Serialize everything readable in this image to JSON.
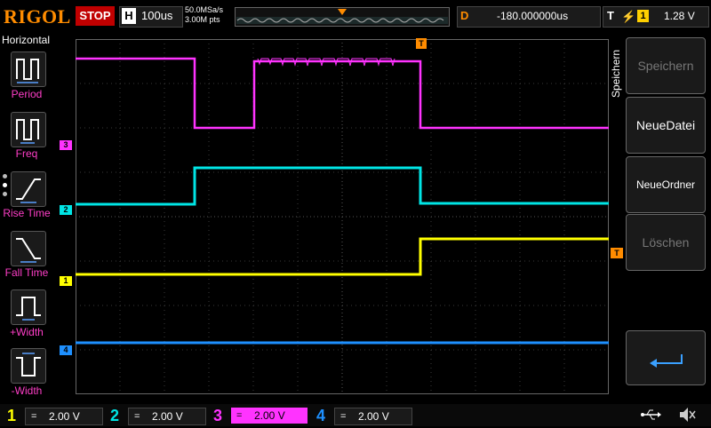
{
  "header": {
    "brand": "RIGOL",
    "run_state": "STOP",
    "timebase_label": "H",
    "timebase_value": "100us",
    "sample_rate": "50.0MSa/s",
    "memory_points": "3.00M pts",
    "delay_label": "D",
    "delay_value": "-180.000000us",
    "trigger_label": "T",
    "trigger_source": "1",
    "trigger_level": "1.28 V"
  },
  "left_menu": {
    "title": "Horizontal",
    "items": [
      {
        "label": "Period",
        "icon": "period-icon"
      },
      {
        "label": "Freq",
        "icon": "frequency-icon"
      },
      {
        "label": "Rise Time",
        "icon": "rise-time-icon"
      },
      {
        "label": "Fall Time",
        "icon": "fall-time-icon"
      },
      {
        "label": "+Width",
        "icon": "positive-width-icon"
      },
      {
        "label": "-Width",
        "icon": "negative-width-icon"
      }
    ]
  },
  "right_menu": {
    "title": "Speichern",
    "buttons": [
      {
        "label": "Speichern",
        "enabled": false
      },
      {
        "label": "NeueDatei",
        "enabled": true
      },
      {
        "label": "NeueOrdner",
        "enabled": true
      },
      {
        "label": "Löschen",
        "enabled": false
      }
    ],
    "back_icon": "return-arrow-icon",
    "mute_icon": "speaker-mute-icon"
  },
  "channels": [
    {
      "num": "1",
      "coupling": "=",
      "scale": "2.00 V",
      "color": "#ffff00"
    },
    {
      "num": "2",
      "coupling": "=",
      "scale": "2.00 V",
      "color": "#00e5e5"
    },
    {
      "num": "3",
      "coupling": "=",
      "scale": "2.00 V",
      "color": "#ff33ff"
    },
    {
      "num": "4",
      "coupling": "=",
      "scale": "2.00 V",
      "color": "#1e90ff"
    }
  ],
  "markers": {
    "ch3": "3",
    "ch2": "2",
    "ch1": "1",
    "ch4": "4",
    "trigger": "T"
  },
  "status": {
    "usb_icon": "usb-icon"
  }
}
